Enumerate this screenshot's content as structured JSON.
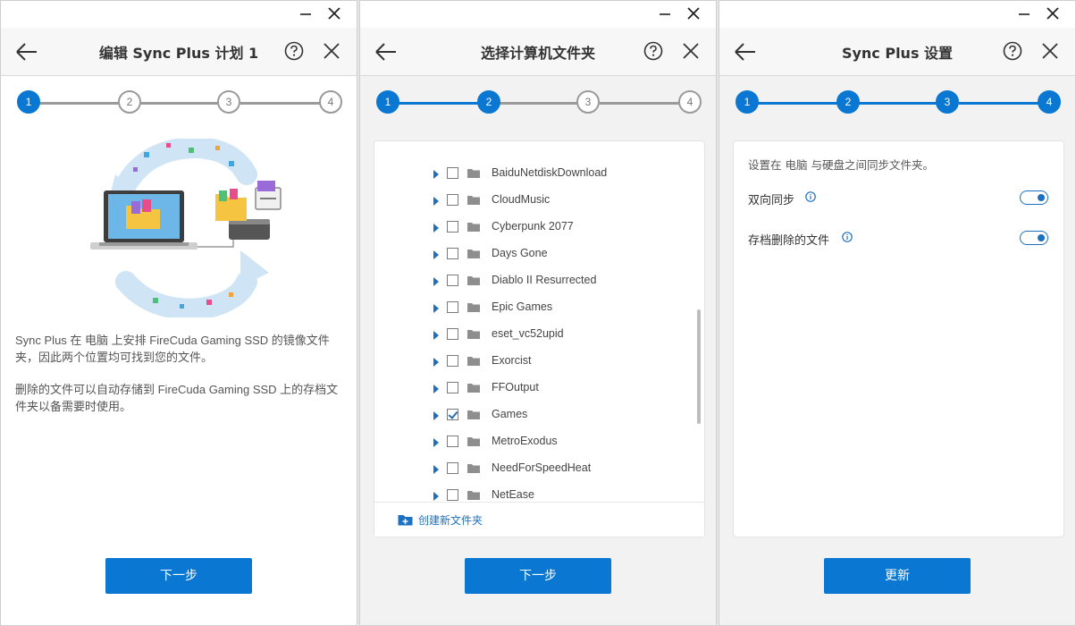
{
  "colors": {
    "accent": "#0a78d2",
    "inactive_step": "#9a9a9a",
    "link": "#1d6fc0"
  },
  "windows": [
    {
      "header": {
        "title": "编辑 Sync Plus 计划 1"
      },
      "stepper": {
        "steps": [
          "1",
          "2",
          "3",
          "4"
        ],
        "current": 1
      },
      "description": [
        "Sync Plus 在 电脑 上安排 FireCuda Gaming SSD 的镜像文件夹，因此两个位置均可找到您的文件。",
        "删除的文件可以自动存储到 FireCuda Gaming SSD 上的存档文件夹以备需要时使用。"
      ],
      "primary_button": "下一步"
    },
    {
      "header": {
        "title": "选择计算机文件夹"
      },
      "stepper": {
        "steps": [
          "1",
          "2",
          "3",
          "4"
        ],
        "current": 2
      },
      "folders": [
        {
          "name": "BaiduNetdiskDownload",
          "checked": false
        },
        {
          "name": "CloudMusic",
          "checked": false
        },
        {
          "name": "Cyberpunk 2077",
          "checked": false
        },
        {
          "name": "Days Gone",
          "checked": false
        },
        {
          "name": "Diablo II Resurrected",
          "checked": false
        },
        {
          "name": "Epic Games",
          "checked": false
        },
        {
          "name": "eset_vc52upid",
          "checked": false
        },
        {
          "name": "Exorcist",
          "checked": false
        },
        {
          "name": "FFOutput",
          "checked": false
        },
        {
          "name": "Games",
          "checked": true
        },
        {
          "name": "MetroExodus",
          "checked": false
        },
        {
          "name": "NeedForSpeedHeat",
          "checked": false
        },
        {
          "name": "NetEase",
          "checked": false
        }
      ],
      "new_folder_label": "创建新文件夹",
      "primary_button": "下一步"
    },
    {
      "header": {
        "title": "Sync Plus 设置"
      },
      "stepper": {
        "steps": [
          "1",
          "2",
          "3",
          "4"
        ],
        "current": 4
      },
      "intro": "设置在 电脑 与硬盘之间同步文件夹。",
      "settings": [
        {
          "label": "双向同步",
          "enabled": true
        },
        {
          "label": "存档删除的文件",
          "enabled": true
        }
      ],
      "primary_button": "更新"
    }
  ]
}
